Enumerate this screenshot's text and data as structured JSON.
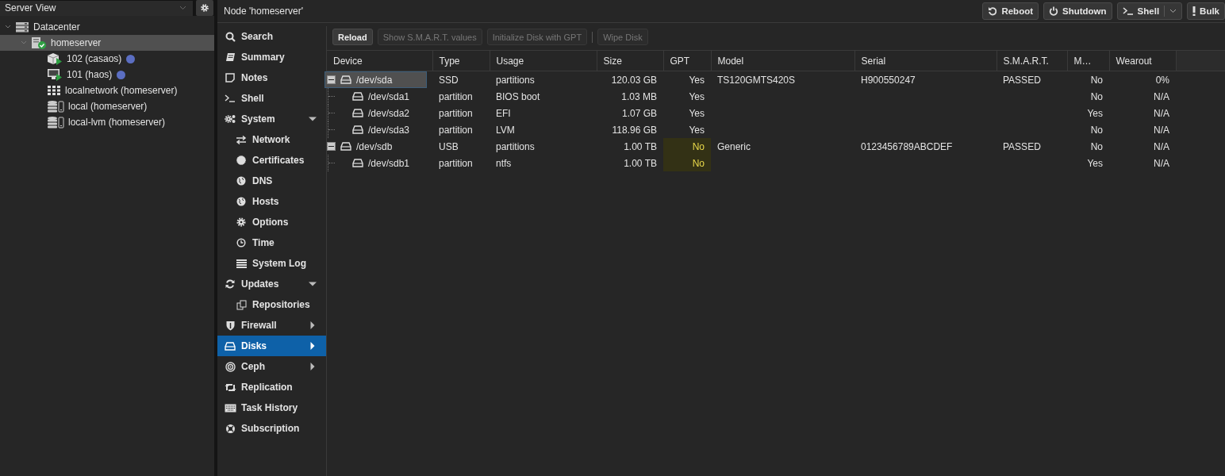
{
  "resource_tree": {
    "view_selector": "Server View",
    "items": [
      {
        "label": "Datacenter",
        "kind": "datacenter",
        "selected": false,
        "expanded": true,
        "children": [
          {
            "label": "homeserver",
            "kind": "node",
            "selected": true,
            "expanded": true,
            "children": [
              {
                "label": "102 (casaos)",
                "kind": "container",
                "selected": false,
                "color": "#5b6ec2"
              },
              {
                "label": "101 (haos)",
                "kind": "vm",
                "selected": false,
                "color": "#5b6ec2"
              },
              {
                "label": "localnetwork (homeserver)",
                "kind": "network",
                "selected": false
              },
              {
                "label": "local (homeserver)",
                "kind": "storage",
                "selected": false
              },
              {
                "label": "local-lvm (homeserver)",
                "kind": "storage",
                "selected": false
              }
            ]
          }
        ]
      }
    ]
  },
  "header": {
    "title": "Node 'homeserver'",
    "buttons": [
      {
        "label": "Reboot",
        "kind": "reboot"
      },
      {
        "label": "Shutdown",
        "kind": "shutdown"
      },
      {
        "label": "Shell",
        "kind": "shell"
      },
      {
        "label": "Bulk",
        "kind": "bulk"
      }
    ]
  },
  "nav": [
    {
      "label": "Search",
      "selected": false
    },
    {
      "label": "Summary",
      "selected": false
    },
    {
      "label": "Notes",
      "selected": false
    },
    {
      "label": "Shell",
      "selected": false
    },
    {
      "label": "System",
      "selected": false,
      "expanded": true,
      "children": [
        {
          "label": "Network",
          "selected": false
        },
        {
          "label": "Certificates",
          "selected": false
        },
        {
          "label": "DNS",
          "selected": false
        },
        {
          "label": "Hosts",
          "selected": false
        },
        {
          "label": "Options",
          "selected": false
        },
        {
          "label": "Time",
          "selected": false
        },
        {
          "label": "System Log",
          "selected": false
        }
      ]
    },
    {
      "label": "Updates",
      "selected": false,
      "expanded": true,
      "children": [
        {
          "label": "Repositories",
          "selected": false
        }
      ]
    },
    {
      "label": "Firewall",
      "selected": false,
      "expanded": false
    },
    {
      "label": "Disks",
      "selected": true,
      "expanded": false
    },
    {
      "label": "Ceph",
      "selected": false,
      "expanded": false
    },
    {
      "label": "Replication",
      "selected": false
    },
    {
      "label": "Task History",
      "selected": false
    },
    {
      "label": "Subscription",
      "selected": false
    }
  ],
  "toolbar": [
    {
      "label": "Reload",
      "disabled": false
    },
    {
      "label": "Show S.M.A.R.T. values",
      "disabled": true
    },
    {
      "label": "Initialize Disk with GPT",
      "disabled": true
    },
    {
      "label": "Wipe Disk",
      "disabled": true
    }
  ],
  "disks": {
    "columns": [
      "Device",
      "Type",
      "Usage",
      "Size",
      "GPT",
      "Model",
      "Serial",
      "S.M.A.R.T.",
      "M…",
      "Wearout"
    ],
    "rows": [
      {
        "device": "/dev/sda",
        "type": "SSD",
        "usage": "partitions",
        "size": "120.03 GB",
        "gpt": "Yes",
        "gpt_warning": false,
        "model": "TS120GMTS420S",
        "serial": "H900550247",
        "smart": "PASSED",
        "mounted": "No",
        "wearout": "0%",
        "selected": true,
        "expanded": true,
        "children": [
          {
            "device": "/dev/sda1",
            "type": "partition",
            "usage": "BIOS boot",
            "size": "1.03 MB",
            "gpt": "Yes",
            "gpt_warning": false,
            "mounted": "No",
            "wearout": "N/A",
            "selected": false
          },
          {
            "device": "/dev/sda2",
            "type": "partition",
            "usage": "EFI",
            "size": "1.07 GB",
            "gpt": "Yes",
            "gpt_warning": false,
            "mounted": "Yes",
            "wearout": "N/A",
            "selected": false
          },
          {
            "device": "/dev/sda3",
            "type": "partition",
            "usage": "LVM",
            "size": "118.96 GB",
            "gpt": "Yes",
            "gpt_warning": false,
            "mounted": "No",
            "wearout": "N/A",
            "selected": false
          }
        ]
      },
      {
        "device": "/dev/sdb",
        "type": "USB",
        "usage": "partitions",
        "size": "1.00 TB",
        "gpt": "No",
        "gpt_warning": true,
        "model": "Generic",
        "serial": "0123456789ABCDEF",
        "smart": "PASSED",
        "mounted": "No",
        "wearout": "N/A",
        "selected": false,
        "expanded": true,
        "children": [
          {
            "device": "/dev/sdb1",
            "type": "partition",
            "usage": "ntfs",
            "size": "1.00 TB",
            "gpt": "No",
            "gpt_warning": true,
            "mounted": "Yes",
            "wearout": "N/A",
            "selected": false
          }
        ]
      }
    ]
  }
}
